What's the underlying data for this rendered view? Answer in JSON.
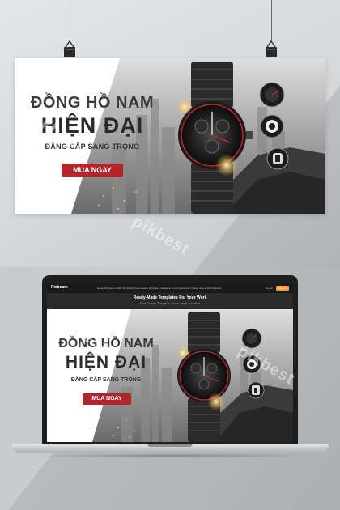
{
  "banner": {
    "line1": "ĐỒNG HỒ NAM",
    "line2": "HIỆN ĐẠI",
    "tagline": "ĐẲNG CẤP SANG TRỌNG",
    "cta": "MUA NGAY"
  },
  "laptop": {
    "nav": {
      "logo": "Pixbeam",
      "links": "Email Templates   Office Templates   Presentation Templates   Wallpaper   Fonts   Illustrations   Videos   Sound Effects   Music",
      "login": "Log in",
      "signup": "Sign up"
    },
    "hero_title": "Ready-Made Templates For Your Work",
    "hero_subtitle": "Free Graphic Templates, Stock Image and More",
    "banner": {
      "line1": "ĐỒNG HỒ NAM",
      "line2": "HIỆN ĐẠI",
      "tagline": "ĐẲNG CẤP SANG TRỌNG",
      "cta": "MUA NGAY"
    }
  },
  "watermark": "pikbest",
  "colors": {
    "accent": "#b3242b",
    "watch_red": "#c0262c",
    "laptop": "#1d1e20"
  }
}
